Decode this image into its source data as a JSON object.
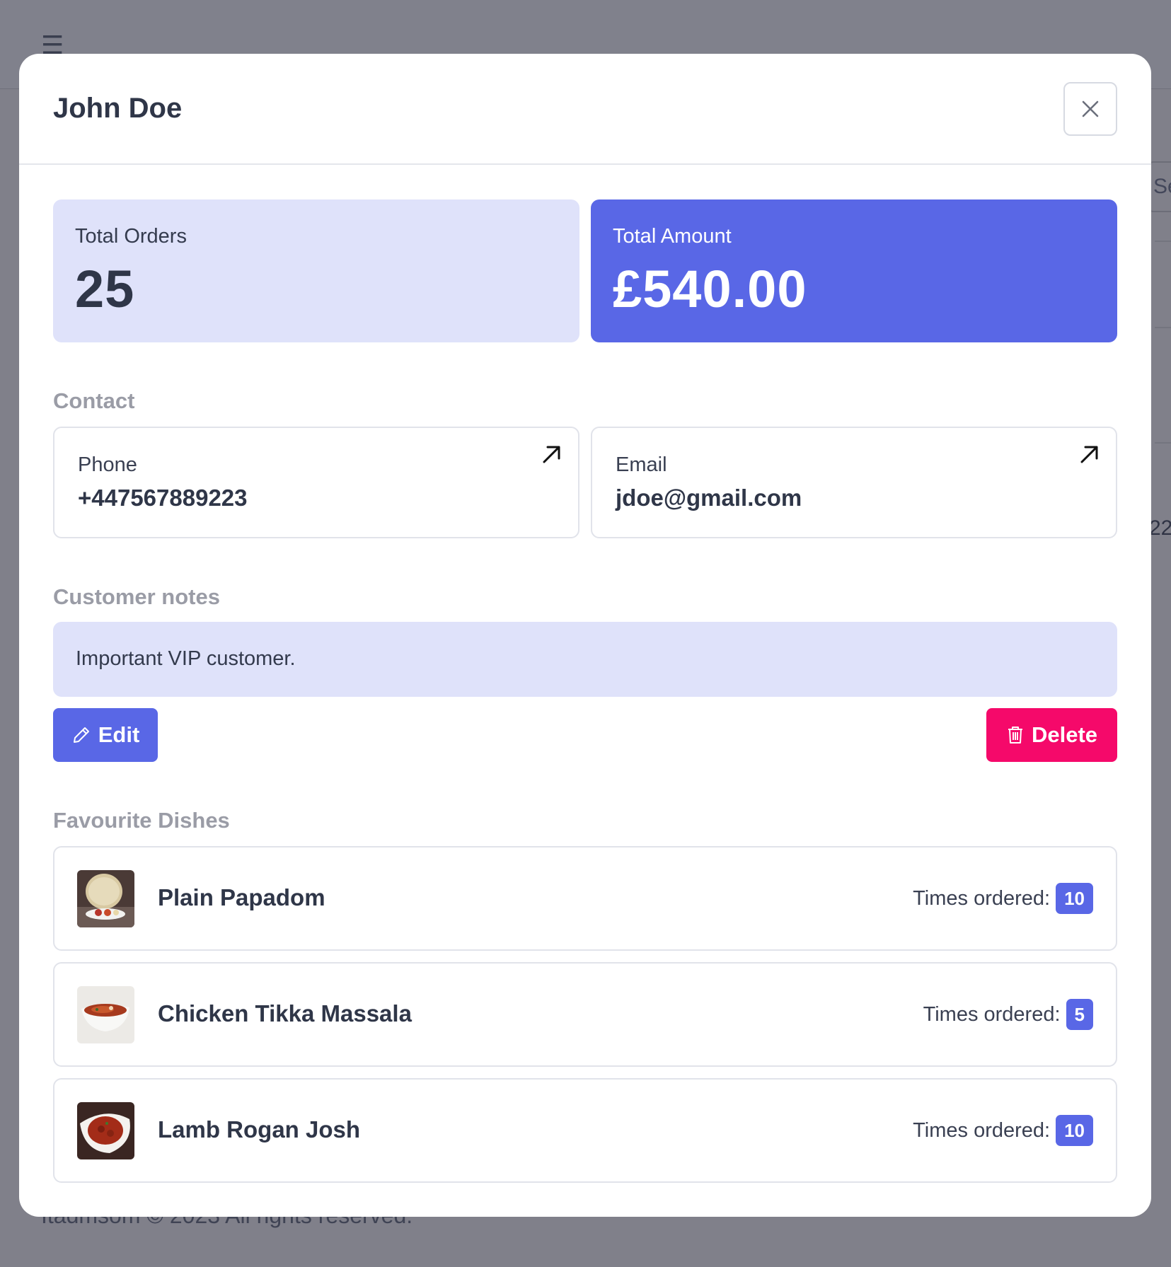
{
  "background": {
    "search_partial": "Se",
    "number_partial": "22",
    "footer_text": "Itadmsom © 2023 All rights reserved."
  },
  "modal": {
    "title": "John Doe",
    "close_icon": "close-icon"
  },
  "stats": {
    "orders_label": "Total Orders",
    "orders_value": "25",
    "amount_label": "Total Amount",
    "amount_value": "£540.00"
  },
  "contact": {
    "section_label": "Contact",
    "phone_label": "Phone",
    "phone_value": "+447567889223",
    "email_label": "Email",
    "email_value": "jdoe@gmail.com"
  },
  "notes": {
    "section_label": "Customer notes",
    "text": "Important VIP customer."
  },
  "actions": {
    "edit_label": "Edit",
    "delete_label": "Delete"
  },
  "dishes": {
    "section_label": "Favourite Dishes",
    "items": [
      {
        "name": "Plain Papadom",
        "times_label": "Times ordered:",
        "count": "10"
      },
      {
        "name": "Chicken Tikka Massala",
        "times_label": "Times ordered:",
        "count": "5"
      },
      {
        "name": "Lamb Rogan Josh",
        "times_label": "Times ordered:",
        "count": "10"
      }
    ]
  },
  "colors": {
    "accent": "#5967e6",
    "accent_light": "#dfe2fa",
    "danger": "#f5096a"
  }
}
